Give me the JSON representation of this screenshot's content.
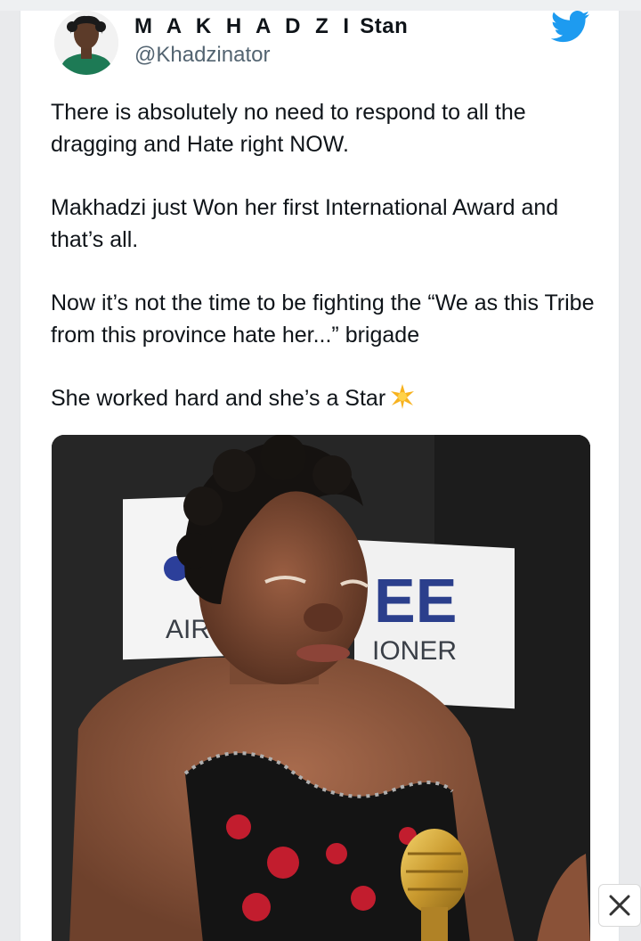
{
  "tweet": {
    "author": {
      "name_spaced": "M A K H A D Z I",
      "name_rest": "Stan",
      "handle": "@Khadzinator"
    },
    "paragraphs": [
      "There is absolutely no need to respond to all the dragging and Hate right NOW.",
      "Makhadzi just Won her first International Award and that’s all.",
      "Now it’s not the time to be fighting the “We as this Tribe from this province hate her...” brigade",
      "She worked hard and she’s a Star"
    ],
    "emoji": "star-emoji",
    "photo_sign": {
      "left_text": "AIR",
      "right_big": "EE",
      "right_small": "IONER"
    }
  },
  "colors": {
    "twitter_blue": "#1d9bf0",
    "text": "#0f1419",
    "secondary_text": "#536471"
  },
  "icons": [
    "twitter-bird-icon",
    "star-emoji-icon",
    "close-icon"
  ]
}
